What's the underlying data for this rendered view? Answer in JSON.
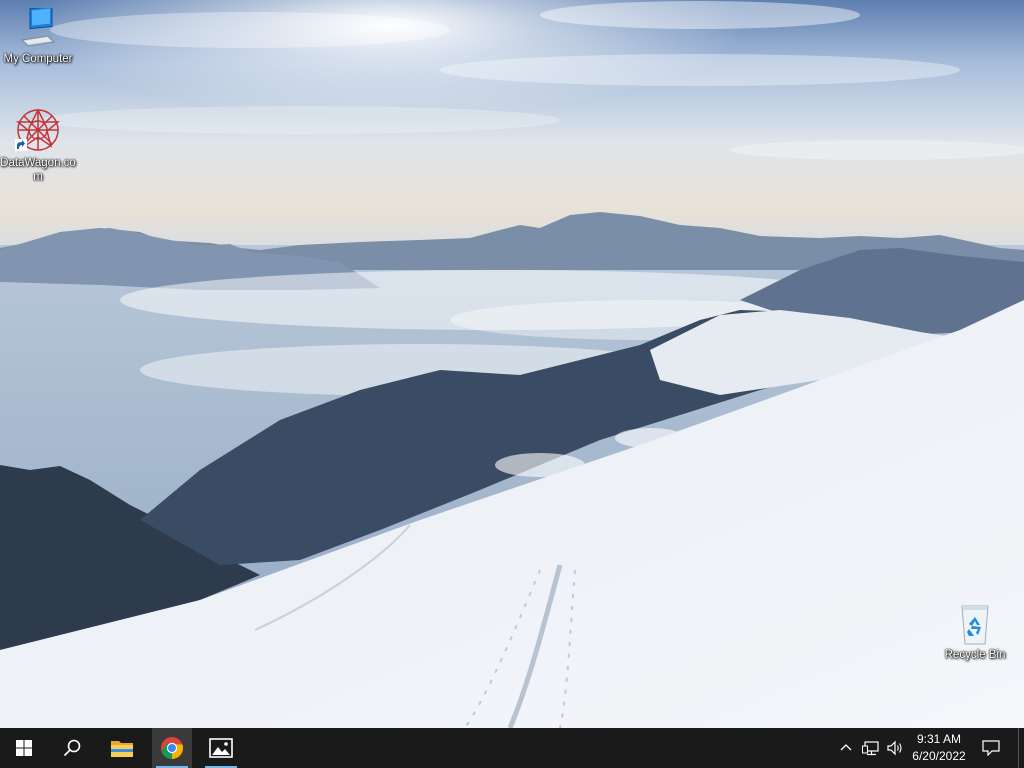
{
  "desktop": {
    "icons": [
      {
        "label": "My Computer",
        "icon": "monitor-icon"
      },
      {
        "label": "DataWagon.com",
        "icon": "datawagon-logo-icon"
      },
      {
        "label": "Recycle Bin",
        "icon": "recycle-bin-icon"
      }
    ]
  },
  "taskbar": {
    "start": {
      "icon": "windows-logo-icon"
    },
    "search": {
      "icon": "search-icon"
    },
    "pinned": [
      {
        "name": "File Explorer",
        "icon": "folder-icon"
      },
      {
        "name": "Google Chrome",
        "icon": "chrome-icon",
        "active": true
      },
      {
        "name": "Photos",
        "icon": "photos-icon",
        "running": true
      }
    ],
    "tray": {
      "icons": [
        "chevron-up-icon",
        "network-icon",
        "volume-icon"
      ],
      "time": "9:31 AM",
      "date": "6/20/2022",
      "notification_icon": "notification-icon"
    }
  },
  "colors": {
    "taskbar": "#1a1a1a",
    "active_indicator": "#76b9ed",
    "chrome_highlight": "#3a3a3a"
  }
}
